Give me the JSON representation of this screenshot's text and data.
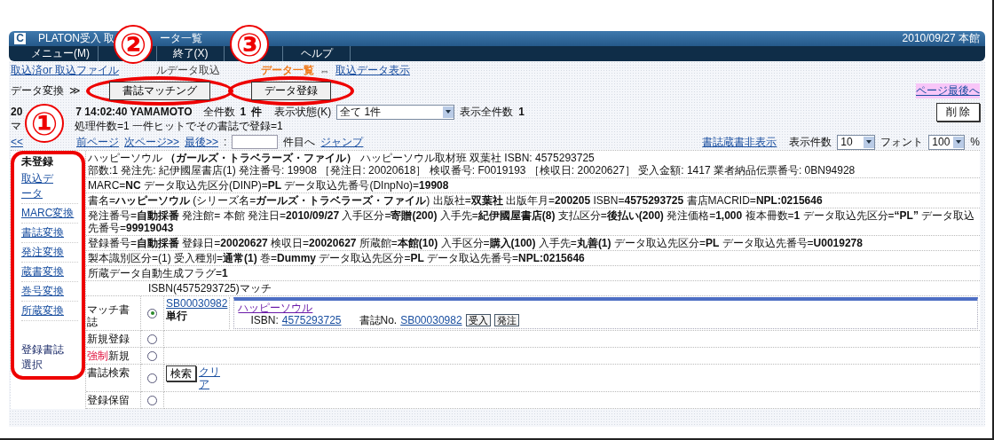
{
  "window": {
    "app_icon": "C",
    "title_parts": [
      "PLATON受入 取",
      "ータ一覧"
    ],
    "date": "2010/09/27 本館"
  },
  "menu": [
    {
      "label": "メニュー(M)"
    },
    {
      "label": "終了(X)"
    },
    {
      "label": "ヘルプ"
    }
  ],
  "breadcrumb": [
    {
      "text": "取込済or 取込ファイル",
      "kind": "link"
    },
    {
      "text": "ルデータ取込",
      "kind": "plain"
    },
    {
      "text": "データ一覧",
      "kind": "current"
    },
    {
      "text": "⇔",
      "kind": "plain"
    },
    {
      "text": "取込データ表示",
      "kind": "link"
    }
  ],
  "toolbar": {
    "label": "データ変換",
    "separator": "≫",
    "buttons": [
      "書誌マッチング",
      "データ登録"
    ],
    "page_end_link": "ページ最後へ"
  },
  "status": {
    "date_prefix": "20",
    "timestamp": "7 14:02:40 YAMAMOTO",
    "total_label": "全件数",
    "total": "1",
    "total_unit": "件",
    "display_state_label": "表示状態(K)",
    "display_state_value": "全て 1件",
    "shown_total_label": "表示全件数",
    "shown_total": "1",
    "delete_button": "削 除"
  },
  "summary_parts": [
    "マ",
    "処理件数=1 一件ヒットでその書誌で登録=1"
  ],
  "pager": {
    "first": "<<",
    "links": [
      "前ページ",
      "次ページ>>",
      "最後>>"
    ],
    "colon": ":",
    "goto_label": "件目へ",
    "jump_link": "ジャンプ",
    "hide_link": "書誌蔵書非表示",
    "per_page_label": "表示件数",
    "per_page": "10",
    "font_label": "フォント",
    "font_size": "100",
    "percent": "%"
  },
  "sidebar": {
    "status": "未登録",
    "links": [
      "取込データ",
      "MARC変換",
      "書誌変換",
      "発注変換",
      "蔵書変換",
      "巻号変換",
      "所蔵変換"
    ],
    "footer": "登録書誌選択"
  },
  "records": [
    {
      "lines": [
        "ハッピーソウル **（ガールズ・トラベラーズ・ファイル）** ハッピーソウル取材班 双葉社 ISBN: 4575293725",
        "部数:1 発注先: 紀伊國屋書店(1) 発注番号: 19908 ［発注日: 20020618］ 検収番号: F0019193 ［検収日: 20020627］ 受入金額: 1417 業者納品伝票番号: 0BN94928"
      ]
    },
    {
      "lines": [
        "MARC=**NC** データ取込先区分(DINP)=**PL** データ取込先番号(DInpNo)=**19908**"
      ]
    },
    {
      "lines": [
        "書名=**ハッピーソウル** (シリーズ名=**ガールズ・トラベラーズ・ファイル**) 出版社=**双葉社** 出版年月=**200205** ISBN=**4575293725** 書店MACRID=**NPL:0215646**"
      ]
    },
    {
      "lines": [
        "発注番号=**自動採番** 発注館= 本館 発注日=**2010/09/27** 入手区分=**寄贈(200)** 入手先=**紀伊國屋書店(8)** 支払区分=**後払い(200)** 発注価格=**1,000** 複本冊数=**1** データ取込先区分=**“PL”** データ取込先番号=**99919043**"
      ]
    },
    {
      "lines": [
        "登録番号=**自動採番** 登録日=**20020627** 検収日=**20020627** 所蔵館=**本館(10)** 入手区分=**購入(100)** 入手先=**丸善(1)** データ取込先区分=**PL** データ取込先番号=**U0019278**"
      ]
    },
    {
      "lines": [
        "製本識別区分=(1) 受入種別=**通常(1)** 巻=**Dummy** データ取込先区分=**PL** データ取込先番号=**NPL:0215646**"
      ]
    },
    {
      "lines": [
        "所蔵データ自動生成フラグ=**1**"
      ]
    }
  ],
  "match": {
    "header": "ISBN(4575293725)マッチ",
    "options": [
      {
        "kind": "match",
        "label_parts": [
          {
            "text": "マッチ書誌",
            "warning": false
          }
        ],
        "selected": true,
        "bib_link": "SB00030982",
        "bib_type": "単行",
        "title": "ハッピーソウル",
        "isbn_label": "ISBN:",
        "isbn": "4575293725",
        "bibno_label": "書誌No.",
        "bibno": "SB00030982",
        "tags": [
          "受入",
          "発注"
        ]
      },
      {
        "kind": "plain",
        "label_parts": [
          {
            "text": "新規登録",
            "warning": false
          }
        ],
        "selected": false
      },
      {
        "kind": "plain",
        "label_parts": [
          {
            "text": "強制",
            "warning": true
          },
          {
            "text": "新規",
            "warning": false
          }
        ],
        "selected": false
      },
      {
        "kind": "search",
        "label_parts": [
          {
            "text": "書誌検索",
            "warning": false
          }
        ],
        "selected": false,
        "button": "検索",
        "clear_link": "クリア"
      },
      {
        "kind": "plain",
        "label_parts": [
          {
            "text": "登録保留",
            "warning": false
          }
        ],
        "selected": false
      }
    ]
  },
  "annotations": [
    {
      "number": "①"
    },
    {
      "number": "②"
    },
    {
      "number": "③"
    }
  ]
}
